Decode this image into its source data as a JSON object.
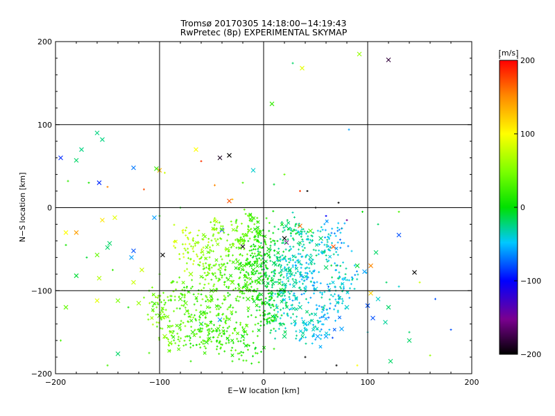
{
  "chart_data": {
    "type": "scatter",
    "title": "Tromsø 20170305 14:18:00−14:19:43",
    "subtitle": "RwPretec (8p) EXPERIMENTAL SKYMAP",
    "xlabel": "E−W location [km]",
    "ylabel": "N−S location [km]",
    "xlim": [
      -200,
      200
    ],
    "ylim": [
      -200,
      200
    ],
    "xticks": [
      -200,
      -100,
      0,
      100,
      200
    ],
    "yticks": [
      -200,
      -100,
      0,
      100,
      200
    ],
    "xtick_labels": [
      "−200",
      "−100",
      "0",
      "100",
      "200"
    ],
    "ytick_labels": [
      "−200",
      "−100",
      "0",
      "100",
      "200"
    ],
    "grid": true,
    "colorbar": {
      "label": "[m/s]",
      "range": [
        -200,
        200
      ],
      "ticks": [
        200,
        100,
        0,
        -100,
        -200
      ],
      "tick_labels": [
        "200",
        "100",
        "0",
        "−100",
        "−200"
      ],
      "colormap": "rainbow (black–purple–blue–cyan–green–yellow–red)"
    },
    "series": [
      {
        "marker": "x",
        "points": [
          [
            -195,
            60,
            -90
          ],
          [
            -180,
            57,
            -20
          ],
          [
            -175,
            70,
            -25
          ],
          [
            -160,
            90,
            -25
          ],
          [
            -155,
            82,
            -25
          ],
          [
            -158,
            30,
            -90
          ],
          [
            -125,
            48,
            -70
          ],
          [
            -100,
            45,
            130
          ],
          [
            -103,
            47,
            20
          ],
          [
            -65,
            70,
            100
          ],
          [
            -42,
            60,
            -190
          ],
          [
            -33,
            63,
            -200
          ],
          [
            -10,
            45,
            -40
          ],
          [
            -33,
            8,
            170
          ],
          [
            8,
            125,
            20
          ],
          [
            37,
            168,
            90
          ],
          [
            92,
            185,
            60
          ],
          [
            120,
            178,
            -180
          ],
          [
            -190,
            -30,
            100
          ],
          [
            -180,
            -30,
            140
          ],
          [
            -155,
            -15,
            110
          ],
          [
            -143,
            -12,
            90
          ],
          [
            -148,
            -43,
            -20
          ],
          [
            -150,
            -48,
            -20
          ],
          [
            -180,
            -82,
            -10
          ],
          [
            -125,
            -52,
            -80
          ],
          [
            -127,
            -60,
            -60
          ],
          [
            -105,
            -12,
            -60
          ],
          [
            -97,
            -57,
            -200
          ],
          [
            -117,
            -75,
            80
          ],
          [
            -160,
            -57,
            40
          ],
          [
            -158,
            -85,
            70
          ],
          [
            -190,
            -120,
            40
          ],
          [
            -160,
            -112,
            90
          ],
          [
            -140,
            -112,
            50
          ],
          [
            -125,
            -90,
            80
          ],
          [
            -120,
            -115,
            60
          ],
          [
            -100,
            -130,
            40
          ],
          [
            -95,
            -155,
            60
          ],
          [
            -90,
            -163,
            50
          ],
          [
            -68,
            -150,
            20
          ],
          [
            -55,
            -162,
            10
          ],
          [
            -140,
            -176,
            -20
          ],
          [
            -60,
            -140,
            -20
          ],
          [
            -40,
            -27,
            -80
          ],
          [
            -20,
            -47,
            -200
          ],
          [
            20,
            -37,
            -200
          ],
          [
            22,
            -42,
            -150
          ],
          [
            35,
            -22,
            160
          ],
          [
            45,
            -28,
            30
          ],
          [
            55,
            -37,
            -20
          ],
          [
            67,
            -47,
            170
          ],
          [
            90,
            -70,
            -10
          ],
          [
            97,
            -77,
            -60
          ],
          [
            103,
            -70,
            150
          ],
          [
            108,
            -54,
            -20
          ],
          [
            130,
            -33,
            -80
          ],
          [
            145,
            -78,
            -200
          ],
          [
            103,
            -103,
            120
          ],
          [
            100,
            -118,
            -80
          ],
          [
            105,
            -133,
            -80
          ],
          [
            120,
            -120,
            -20
          ],
          [
            117,
            -138,
            -30
          ],
          [
            75,
            -146,
            -60
          ],
          [
            60,
            -155,
            -60
          ],
          [
            52,
            -155,
            -60
          ],
          [
            40,
            -140,
            -40
          ],
          [
            20,
            -155,
            -20
          ],
          [
            -20,
            -155,
            -10
          ],
          [
            -42,
            -135,
            -60
          ],
          [
            -60,
            -128,
            20
          ],
          [
            -75,
            -115,
            40
          ],
          [
            -5,
            -90,
            20
          ],
          [
            10,
            -67,
            -20
          ],
          [
            -10,
            -75,
            10
          ],
          [
            15,
            -105,
            -10
          ],
          [
            -15,
            -110,
            20
          ],
          [
            30,
            -90,
            -30
          ],
          [
            50,
            -98,
            -40
          ],
          [
            60,
            -72,
            -20
          ],
          [
            -30,
            -90,
            40
          ],
          [
            -50,
            -100,
            30
          ],
          [
            -80,
            -110,
            30
          ],
          [
            -70,
            -80,
            60
          ],
          [
            0,
            -115,
            10
          ],
          [
            35,
            -120,
            -30
          ],
          [
            80,
            -120,
            -40
          ],
          [
            110,
            -110,
            -40
          ],
          [
            140,
            -160,
            -20
          ],
          [
            122,
            -185,
            -20
          ],
          [
            -5,
            -30,
            30
          ],
          [
            5,
            -50,
            0
          ],
          [
            25,
            -75,
            -20
          ],
          [
            -35,
            -50,
            50
          ],
          [
            -25,
            -65,
            30
          ],
          [
            45,
            -60,
            -30
          ]
        ]
      },
      {
        "marker": "dot",
        "points": [
          [
            -188,
            32,
            20
          ],
          [
            -168,
            30,
            10
          ],
          [
            -150,
            25,
            150
          ],
          [
            -115,
            22,
            170
          ],
          [
            -95,
            42,
            80
          ],
          [
            -60,
            56,
            180
          ],
          [
            -47,
            27,
            150
          ],
          [
            -30,
            10,
            130
          ],
          [
            -20,
            30,
            30
          ],
          [
            10,
            28,
            -10
          ],
          [
            20,
            40,
            40
          ],
          [
            35,
            20,
            180
          ],
          [
            42,
            20,
            -200
          ],
          [
            72,
            6,
            -200
          ],
          [
            82,
            94,
            -60
          ],
          [
            28,
            174,
            -20
          ],
          [
            -80,
            0,
            0
          ],
          [
            -100,
            -10,
            10
          ],
          [
            -190,
            -45,
            10
          ],
          [
            -170,
            -60,
            -10
          ],
          [
            -145,
            -75,
            20
          ],
          [
            -130,
            -120,
            10
          ],
          [
            -110,
            -100,
            30
          ],
          [
            -100,
            -80,
            30
          ],
          [
            110,
            -20,
            -20
          ],
          [
            130,
            -5,
            30
          ],
          [
            150,
            -90,
            80
          ],
          [
            165,
            -110,
            -80
          ],
          [
            180,
            -147,
            -80
          ],
          [
            160,
            -178,
            60
          ],
          [
            140,
            -150,
            -20
          ],
          [
            130,
            -95,
            -40
          ],
          [
            118,
            -90,
            -20
          ],
          [
            100,
            -150,
            -40
          ],
          [
            90,
            -190,
            100
          ],
          [
            70,
            -190,
            -200
          ],
          [
            40,
            -180,
            -200
          ],
          [
            10,
            -170,
            20
          ],
          [
            -30,
            -185,
            20
          ],
          [
            -70,
            -185,
            20
          ],
          [
            -110,
            -175,
            30
          ],
          [
            -150,
            -190,
            30
          ],
          [
            -195,
            -160,
            30
          ],
          [
            60,
            -10,
            -100
          ],
          [
            75,
            -25,
            -130
          ],
          [
            80,
            -15,
            -150
          ],
          [
            95,
            -5,
            0
          ],
          [
            50,
            0,
            -200
          ]
        ]
      }
    ],
    "cloud": {
      "marker": "dot",
      "points": [
        [
          0,
          -85,
          0
        ],
        [
          -20,
          -100,
          20
        ],
        [
          15,
          -75,
          -30
        ],
        [
          -40,
          -110,
          30
        ],
        [
          30,
          -65,
          -40
        ],
        [
          -60,
          -125,
          30
        ],
        [
          -10,
          -60,
          10
        ],
        [
          45,
          -90,
          -50
        ],
        [
          -30,
          -140,
          30
        ],
        [
          10,
          -120,
          -10
        ],
        [
          -50,
          -80,
          40
        ],
        [
          25,
          -110,
          -40
        ],
        [
          -75,
          -100,
          30
        ],
        [
          -5,
          -40,
          20
        ],
        [
          40,
          -40,
          -30
        ],
        [
          -25,
          -45,
          40
        ],
        [
          60,
          -55,
          -40
        ],
        [
          -90,
          -140,
          40
        ],
        [
          70,
          -110,
          -50
        ],
        [
          -45,
          -160,
          30
        ],
        [
          20,
          -140,
          -30
        ],
        [
          55,
          -130,
          -50
        ],
        [
          -65,
          -60,
          60
        ],
        [
          5,
          -95,
          0
        ],
        [
          -15,
          -80,
          20
        ],
        [
          35,
          -80,
          -40
        ],
        [
          -35,
          -70,
          30
        ],
        [
          15,
          -50,
          -20
        ],
        [
          -55,
          -145,
          30
        ],
        [
          0,
          -130,
          10
        ],
        [
          -80,
          -160,
          30
        ],
        [
          80,
          -85,
          -40
        ],
        [
          -100,
          -115,
          40
        ],
        [
          -20,
          -170,
          20
        ],
        [
          50,
          -150,
          -50
        ],
        [
          -70,
          -40,
          70
        ],
        [
          25,
          -25,
          -20
        ],
        [
          -40,
          -30,
          50
        ],
        [
          65,
          -35,
          -50
        ],
        [
          -10,
          -20,
          30
        ]
      ]
    }
  }
}
